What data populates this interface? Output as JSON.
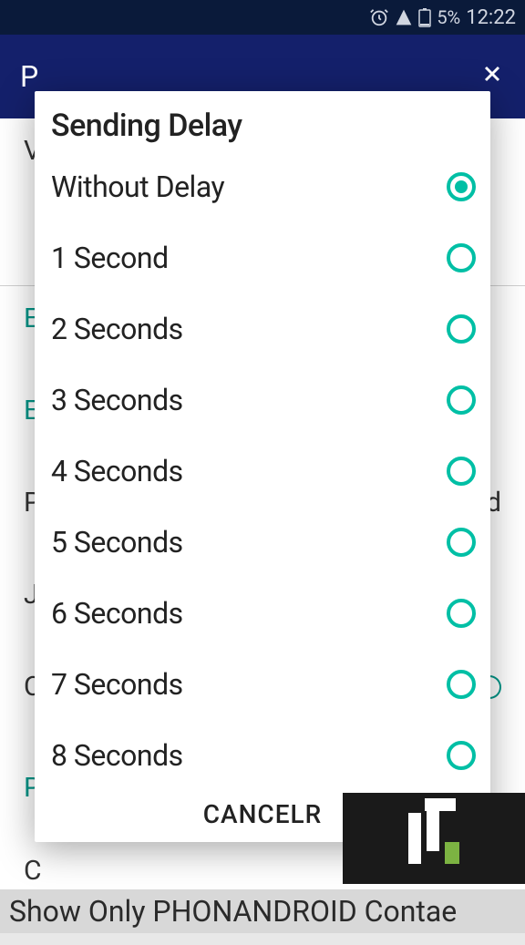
{
  "status_bar": {
    "battery_pct": "5%",
    "time": "12:22"
  },
  "dialog": {
    "title": "Sending Delay",
    "options": [
      {
        "label": "Without Delay",
        "selected": true
      },
      {
        "label": "1 Second",
        "selected": false
      },
      {
        "label": "2 Seconds",
        "selected": false
      },
      {
        "label": "3 Seconds",
        "selected": false
      },
      {
        "label": "4 Seconds",
        "selected": false
      },
      {
        "label": "5 Seconds",
        "selected": false
      },
      {
        "label": "6 Seconds",
        "selected": false
      },
      {
        "label": "7 Seconds",
        "selected": false
      },
      {
        "label": "8 Seconds",
        "selected": false
      }
    ],
    "cancel_label": "CANCELR"
  },
  "ticker": {
    "text": "Show Only PHONANDROID Contae"
  },
  "colors": {
    "accent": "#00bfa5",
    "header": "#14206b"
  }
}
